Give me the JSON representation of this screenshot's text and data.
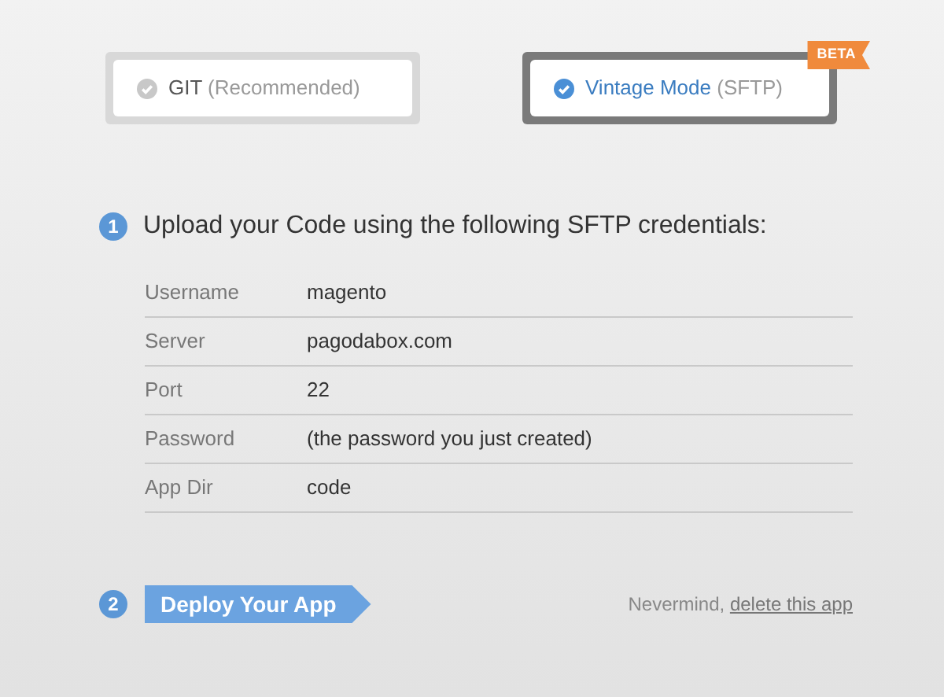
{
  "modes": [
    {
      "label": "GIT",
      "note": "(Recommended)",
      "selected": false
    },
    {
      "label": "Vintage Mode",
      "note": "(SFTP)",
      "selected": true,
      "badge": "BETA"
    }
  ],
  "step_1": {
    "number": "1",
    "title": "Upload your Code using the following SFTP credentials:"
  },
  "credentials": [
    {
      "label": "Username",
      "value": "magento"
    },
    {
      "label": "Server",
      "value": "pagodabox.com"
    },
    {
      "label": "Port",
      "value": "22"
    },
    {
      "label": "Password",
      "value": "(the password you just created)"
    },
    {
      "label": "App Dir",
      "value": "code"
    }
  ],
  "step_2": {
    "number": "2",
    "button": "Deploy Your App"
  },
  "cancel": {
    "text": "Nevermind,",
    "link": "delete this app"
  }
}
